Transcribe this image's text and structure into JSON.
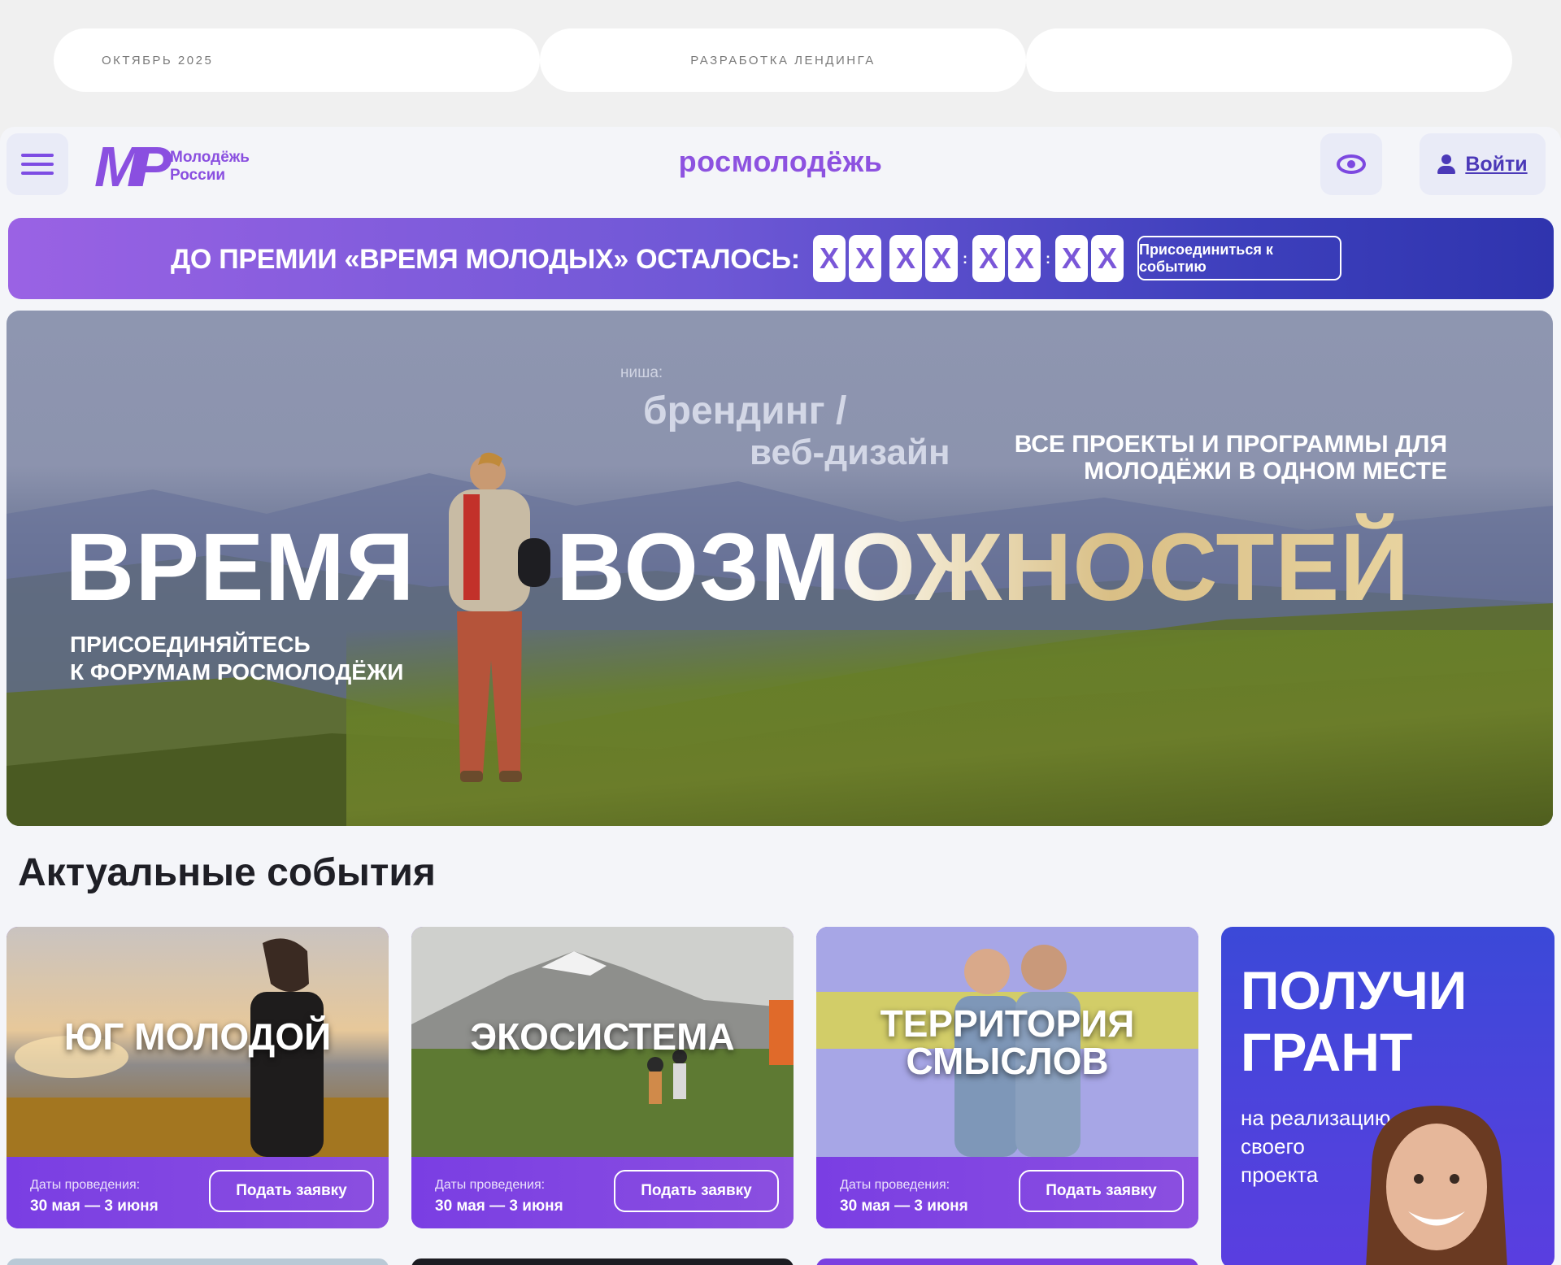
{
  "top_pills": [
    "ОКТЯБРЬ 2025",
    "РАЗРАБОТКА ЛЕНДИНГА",
    ""
  ],
  "header": {
    "logo_mark": "МР",
    "logo_line1": "Молодёжь",
    "logo_line2": "России",
    "brand": "росмолодёжь",
    "login_label": "Войти"
  },
  "countdown": {
    "title": "ДО ПРЕМИИ «ВРЕМЯ МОЛОДЫХ» ОСТАЛОСЬ:",
    "digits": [
      "X",
      "X",
      "X",
      "X",
      "X",
      "X",
      "X",
      "X"
    ],
    "separator": ":",
    "join_label": "Присоединиться к событию"
  },
  "hero": {
    "niche_label": "ниша:",
    "niche_line1": "брендинг /",
    "niche_line2": "веб-дизайн",
    "tagline": "ВСЕ ПРОЕКТЫ И ПРОГРАММЫ ДЛЯ МОЛОДЁЖИ В ОДНОМ МЕСТЕ",
    "big_word1": "ВРЕМЯ",
    "big_word2": "ВОЗМОЖНОСТЕЙ",
    "subtitle_line1": "ПРИСОЕДИНЯЙТЕСЬ",
    "subtitle_line2": "К ФОРУМАМ РОСМОЛОДЁЖИ"
  },
  "section_title": "Актуальные события",
  "events": [
    {
      "name": "ЮГ МОЛОДОЙ",
      "date_label": "Даты проведения:",
      "date_value": "30 мая — 3 июня",
      "apply_label": "Подать заявку"
    },
    {
      "name": "ЭКОСИСТЕМА",
      "date_label": "Даты проведения:",
      "date_value": "30 мая — 3 июня",
      "apply_label": "Подать заявку"
    },
    {
      "name": "ТЕРРИТОРИЯ СМЫСЛОВ",
      "date_label": "Даты проведения:",
      "date_value": "30 мая — 3 июня",
      "apply_label": "Подать заявку"
    }
  ],
  "grant": {
    "title_line1": "ПОЛУЧИ",
    "title_line2": "ГРАНТ",
    "sub_line1": "на реализацию",
    "sub_line2": "своего",
    "sub_line3": "проекта"
  },
  "colors": {
    "accent": "#8a4fe0",
    "countdown_start": "#9a62e4",
    "countdown_end": "#2f34ae",
    "card_footer": "#7b3fe0",
    "grant_bg": "#3b49d8"
  },
  "icons": [
    "menu-icon",
    "eye-icon",
    "user-icon"
  ]
}
